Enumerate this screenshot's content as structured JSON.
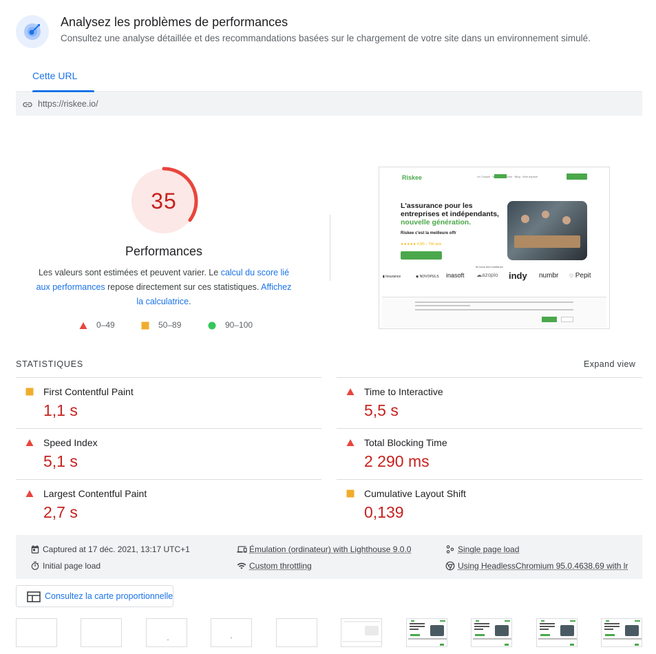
{
  "header": {
    "title": "Analysez les problèmes de performances",
    "subtitle": "Consultez une analyse détaillée et des recommandations basées sur le chargement de votre site dans un environnement simulé."
  },
  "tabs": [
    {
      "label": "Cette URL",
      "active": true
    }
  ],
  "url": "https://riskee.io/",
  "score": {
    "value": "35",
    "fraction": 0.35,
    "label": "Performances",
    "color": "#c5221f",
    "desc_1": "Les valeurs sont estimées et peuvent varier. Le ",
    "desc_link_1": "calcul du score lié aux performances",
    "desc_2": " repose directement sur ces statistiques. ",
    "desc_link_2": "Affichez la calculatrice",
    "desc_3": "."
  },
  "legend": [
    {
      "label": "0–49",
      "shape": "triangle",
      "color": "#e8453c"
    },
    {
      "label": "50–89",
      "shape": "square",
      "color": "#f0ad2c"
    },
    {
      "label": "90–100",
      "shape": "circle",
      "color": "#34c759"
    }
  ],
  "screenshot": {
    "logo": "Riskee",
    "nav": "Le Cockpit   ·   Nos assurances   ·   Blog   ·   Mon espace",
    "headline_1": "L'assurance pour les entreprises et indépendants,",
    "headline_2": "nouvelle génération.",
    "sub": "Riskee c'est la meilleure offr",
    "stars": "★★★★★   4,8/5 – 760 avis",
    "trust": "Ils nous font confiance",
    "logos": [
      "▮ Insurance",
      "◉ NOVOPULS",
      "inasoft",
      "☁azopio",
      "indy",
      "numbr",
      "◌ Pepit"
    ]
  },
  "stats": {
    "title": "STATISTIQUES",
    "expand": "Expand view",
    "metrics": [
      {
        "label": "First Contentful Paint",
        "value": "1,1 s",
        "rating": "square"
      },
      {
        "label": "Time to Interactive",
        "value": "5,5 s",
        "rating": "triangle"
      },
      {
        "label": "Speed Index",
        "value": "5,1 s",
        "rating": "triangle"
      },
      {
        "label": "Total Blocking Time",
        "value": "2 290 ms",
        "rating": "triangle"
      },
      {
        "label": "Largest Contentful Paint",
        "value": "2,7 s",
        "rating": "triangle"
      },
      {
        "label": "Cumulative Layout Shift",
        "value": "0,139",
        "rating": "square"
      }
    ]
  },
  "runtime": {
    "captured": "Captured at 17 déc. 2021, 13:17 UTC+1",
    "initial": "Initial page load",
    "emulation": "Émulation (ordinateur) with Lighthouse 9.0.0",
    "throttling": "Custom throttling",
    "single": "Single page load",
    "using": "Using HeadlessChromium 95.0.4638.69 with lr"
  },
  "treemap": {
    "label": "Consultez la carte proportionnelle"
  },
  "colors": {
    "accent": "#1a73e8",
    "fail": "#c5221f",
    "average": "#f0ad2c",
    "pass": "#34c759"
  }
}
